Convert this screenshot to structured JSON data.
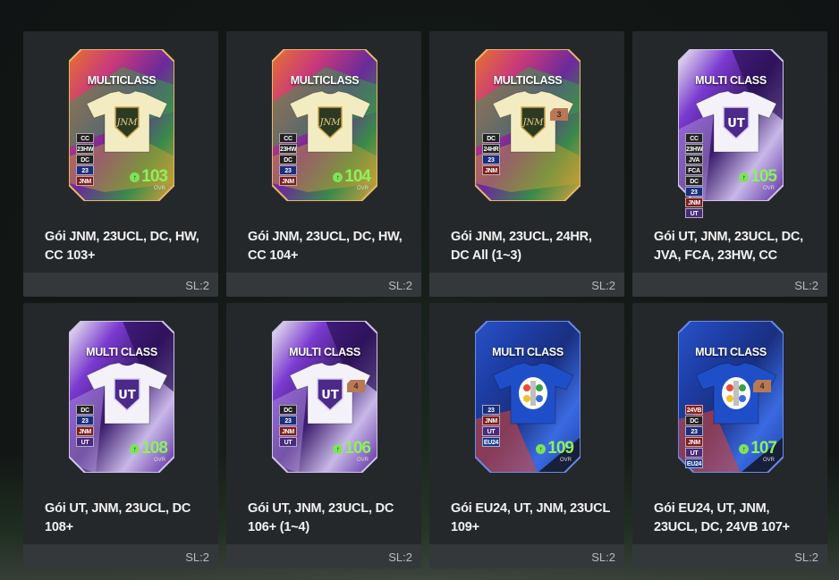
{
  "packs": [
    {
      "name": "Gói JNM, 23UCL, DC, HW, CC 103+",
      "qty": "SL:2",
      "card_title": "MULTICLASS",
      "ovr": "103",
      "ovr_label": "OVR",
      "style": "ucl",
      "shirt": "cream",
      "level": "",
      "badges": [
        "CC",
        "23HW",
        "DC",
        "23",
        "JNM"
      ]
    },
    {
      "name": "Gói JNM, 23UCL, DC, HW, CC 104+",
      "qty": "SL:2",
      "card_title": "MULTICLASS",
      "ovr": "104",
      "ovr_label": "OVR",
      "style": "ucl",
      "shirt": "cream",
      "level": "",
      "badges": [
        "CC",
        "23HW",
        "DC",
        "23",
        "JNM"
      ]
    },
    {
      "name": "Gói JNM, 23UCL, 24HR, DC All (1~3)",
      "qty": "SL:2",
      "card_title": "MULTICLASS",
      "ovr": "",
      "ovr_label": "",
      "style": "ucl",
      "shirt": "cream",
      "level": "3",
      "badges": [
        "DC",
        "24HR",
        "23",
        "JNM"
      ]
    },
    {
      "name": "Gói UT, JNM, 23UCL, DC, JVA, FCA, 23HW, CC",
      "qty": "SL:2",
      "card_title": "MULTI CLASS",
      "ovr": "105",
      "ovr_label": "OVR",
      "style": "ut",
      "shirt": "white",
      "level": "",
      "badges": [
        "CC",
        "23HW",
        "JVA",
        "FCA",
        "DC",
        "23",
        "JNM",
        "UT"
      ]
    },
    {
      "name": "Gói UT, JNM, 23UCL, DC 108+",
      "qty": "SL:2",
      "card_title": "MULTI CLASS",
      "ovr": "108",
      "ovr_label": "OVR",
      "style": "ut",
      "shirt": "white",
      "level": "",
      "badges": [
        "DC",
        "23",
        "JNM",
        "UT"
      ]
    },
    {
      "name": "Gói UT, JNM, 23UCL, DC 106+ (1~4)",
      "qty": "SL:2",
      "card_title": "MULTI CLASS",
      "ovr": "106",
      "ovr_label": "OVR",
      "style": "ut",
      "shirt": "white",
      "level": "4",
      "badges": [
        "DC",
        "23",
        "JNM",
        "UT"
      ]
    },
    {
      "name": "Gói EU24, UT, JNM, 23UCL 109+",
      "qty": "SL:2",
      "card_title": "MULTI CLASS",
      "ovr": "109",
      "ovr_label": "OVR",
      "style": "eu",
      "shirt": "blue",
      "level": "",
      "badges": [
        "23",
        "JNM",
        "UT",
        "EU24"
      ]
    },
    {
      "name": "Gói EU24, UT, JNM, 23UCL, DC, 24VB 107+",
      "qty": "SL:2",
      "card_title": "MULTI CLASS",
      "ovr": "107",
      "ovr_label": "OVR",
      "style": "eu",
      "shirt": "blue",
      "level": "4",
      "badges": [
        "24VB",
        "DC",
        "23",
        "JNM",
        "UT",
        "EU24"
      ]
    }
  ],
  "colors": {
    "tile_bg": "#25282b",
    "footer_bg": "#34383b",
    "ovr_green": "#8df05f"
  }
}
